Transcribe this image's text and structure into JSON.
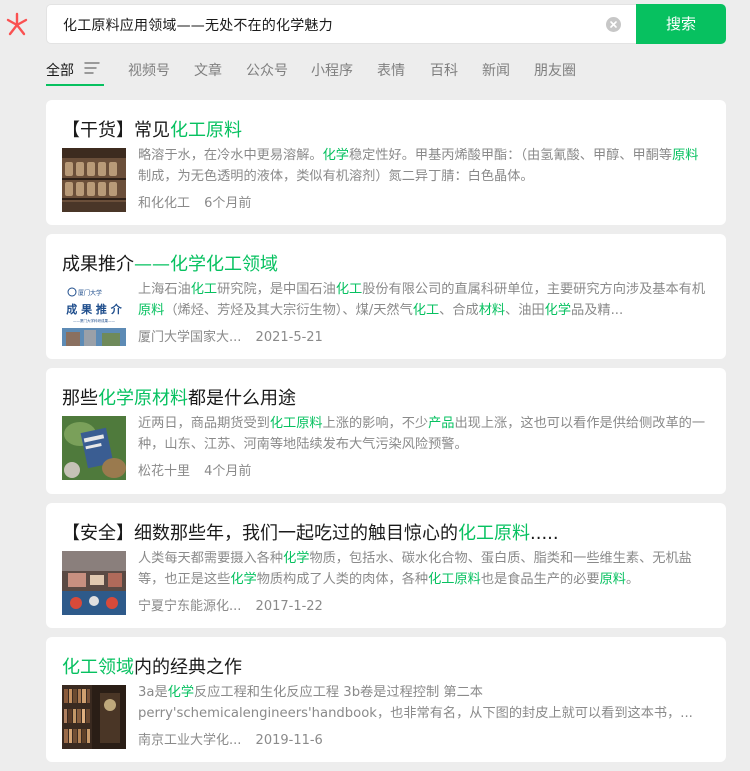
{
  "search": {
    "query": "化工原料应用领域——无处不在的化学魅力",
    "button_label": "搜索"
  },
  "tabs": [
    {
      "label": "全部"
    },
    {
      "label": "视频号"
    },
    {
      "label": "文章"
    },
    {
      "label": "公众号"
    },
    {
      "label": "小程序"
    },
    {
      "label": "表情"
    },
    {
      "label": "百科"
    },
    {
      "label": "新闻"
    },
    {
      "label": "朋友圈"
    }
  ],
  "colors": {
    "accent": "#07c160",
    "logo": "#fa5151"
  },
  "results": [
    {
      "title": [
        {
          "t": "【干货】常见"
        },
        {
          "t": "化工原料",
          "hl": true
        }
      ],
      "snippet": [
        {
          "t": "略溶于水，在冷水中更易溶解。"
        },
        {
          "t": "化学",
          "hl": true
        },
        {
          "t": "稳定性好。甲基丙烯酸甲酯：（由氢氰酸、甲醇、甲酮等"
        },
        {
          "t": "原料",
          "hl": true
        },
        {
          "t": "制成，为无色透明的液体，类似有机溶剂）氮二异丁腈：白色晶体。"
        }
      ],
      "source": "和化化工",
      "time": "6个月前"
    },
    {
      "title": [
        {
          "t": "成果推介"
        },
        {
          "t": "——化学化工领域",
          "hl": true
        }
      ],
      "snippet": [
        {
          "t": "上海石油"
        },
        {
          "t": "化工",
          "hl": true
        },
        {
          "t": "研究院，是中国石油"
        },
        {
          "t": "化工",
          "hl": true
        },
        {
          "t": "股份有限公司的直属科研单位，主要研究方向涉及基本有机"
        },
        {
          "t": "原料",
          "hl": true
        },
        {
          "t": "（烯烃、芳烃及其大宗衍生物）、煤/天然气"
        },
        {
          "t": "化工",
          "hl": true
        },
        {
          "t": "、合成"
        },
        {
          "t": "材料",
          "hl": true
        },
        {
          "t": "、油田"
        },
        {
          "t": "化学",
          "hl": true
        },
        {
          "t": "品及精..."
        }
      ],
      "source": "厦门大学国家大...",
      "time": "2021-5-21",
      "thumb_school": "厦门大学",
      "thumb_title": "成 果 推 介",
      "thumb_sub": "——厦门大学科研成果——"
    },
    {
      "title": [
        {
          "t": "那些"
        },
        {
          "t": "化学原材料",
          "hl": true
        },
        {
          "t": "都是什么用途"
        }
      ],
      "snippet": [
        {
          "t": "近两日，商品期货受到"
        },
        {
          "t": "化工原料",
          "hl": true
        },
        {
          "t": "上涨的影响，不少"
        },
        {
          "t": "产品",
          "hl": true
        },
        {
          "t": "出现上涨，这也可以看作是供给侧改革的一种，山东、江苏、河南等地陆续发布大气污染风险预警。"
        }
      ],
      "source": "松花十里",
      "time": "4个月前"
    },
    {
      "title": [
        {
          "t": "【安全】细数那些年，我们一起吃过的触目惊心的"
        },
        {
          "t": "化工原料",
          "hl": true
        },
        {
          "t": "....."
        }
      ],
      "snippet": [
        {
          "t": "人类每天都需要摄入各种"
        },
        {
          "t": "化学",
          "hl": true
        },
        {
          "t": "物质，包括水、碳水化合物、蛋白质、脂类和一些维生素、无机盐等，也正是这些"
        },
        {
          "t": "化学",
          "hl": true
        },
        {
          "t": "物质构成了人类的肉体，各种"
        },
        {
          "t": "化工原料",
          "hl": true
        },
        {
          "t": "也是食品生产的必要"
        },
        {
          "t": "原料",
          "hl": true
        },
        {
          "t": "。"
        }
      ],
      "source": "宁夏宁东能源化...",
      "time": "2017-1-22"
    },
    {
      "title": [
        {
          "t": "化工领域",
          "hl": true
        },
        {
          "t": "内的经典之作"
        }
      ],
      "snippet": [
        {
          "t": "3a是"
        },
        {
          "t": "化学",
          "hl": true
        },
        {
          "t": "反应工程和生化反应工程 3b卷是过程控制 第二本 perry'schemicalengineers'handbook，也非常有名，从下图的封皮上就可以看到这本书，..."
        }
      ],
      "source": "南京工业大学化...",
      "time": "2019-11-6"
    }
  ]
}
